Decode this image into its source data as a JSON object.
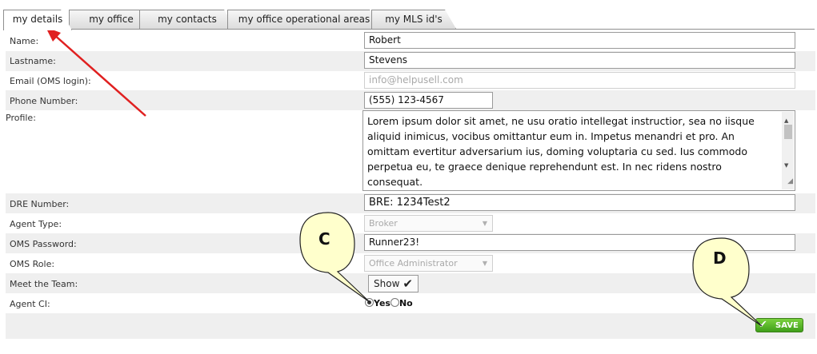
{
  "tabs": [
    {
      "label": "my details",
      "active": true
    },
    {
      "label": "my office",
      "active": false
    },
    {
      "label": "my contacts",
      "active": false
    },
    {
      "label": "my office operational areas",
      "active": false
    },
    {
      "label": "my MLS id's",
      "active": false
    }
  ],
  "form": {
    "name_label": "Name:",
    "name_value": "Robert",
    "lastname_label": "Lastname:",
    "lastname_value": "Stevens",
    "email_label": "Email (OMS login):",
    "email_value": "info@helpusell.com",
    "phone_label": "Phone Number:",
    "phone_value": "(555) 123-4567",
    "profile_label": "Profile:",
    "profile_value": "Lorem ipsum dolor sit amet, ne usu oratio intellegat instructior, sea no iisque aliquid inimicus, vocibus omittantur eum in. Impetus menandri et pro. An omittam evertitur adversarium ius, doming voluptaria cu sed. Ius commodo perpetua eu, te graece denique reprehendunt est. In nec ridens nostro consequat.",
    "dre_label": "DRE Number:",
    "dre_value": "BRE: 1234Test2",
    "agent_type_label": "Agent Type:",
    "agent_type_value": "Broker",
    "oms_password_label": "OMS Password:",
    "oms_password_value": "Runner23!",
    "oms_role_label": "OMS Role:",
    "oms_role_value": "Office Administrator",
    "meet_team_label": "Meet the Team:",
    "meet_team_button": "Show",
    "agent_ci_label": "Agent CI:",
    "agent_ci_yes": "Yes",
    "agent_ci_no": "No",
    "agent_ci_selected": "Yes"
  },
  "save_label": "SAVE",
  "callouts": {
    "c": "C",
    "d": "D"
  },
  "colors": {
    "arrow": "#e02020",
    "callout_fill": "#ffffcc",
    "save_green": "#4caf1f",
    "row_shade": "#efefef"
  }
}
